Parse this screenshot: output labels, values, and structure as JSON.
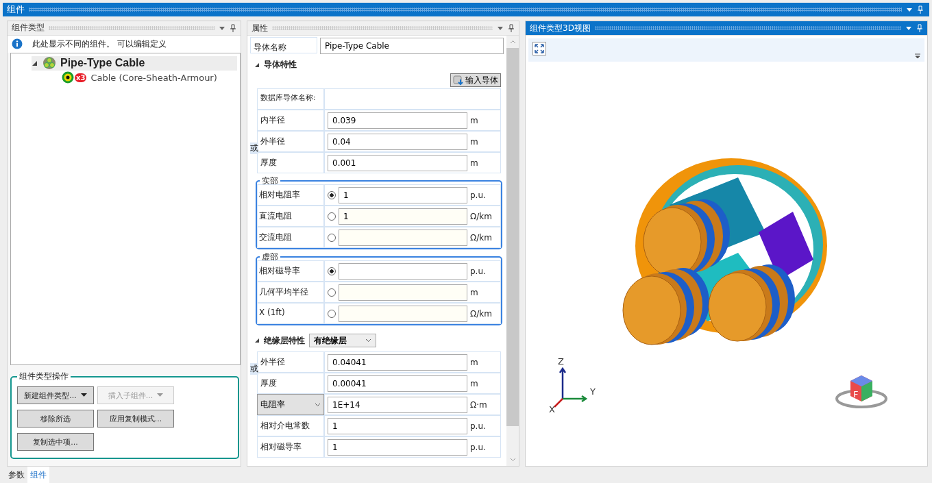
{
  "window": {
    "title": "组件"
  },
  "component_types": {
    "title": "组件类型",
    "info": "此处显示不同的组件。 可以编辑定义",
    "tree": [
      {
        "label": "Pipe-Type Cable",
        "expanded": true,
        "selected": true,
        "children": [
          {
            "label": "Cable (Core-Sheath-Armour)",
            "badge": "x3",
            "selected": false
          }
        ]
      }
    ],
    "operations": {
      "title": "组件类型操作",
      "buttons": [
        {
          "label": "新建组件类型...",
          "kind": "dropdown",
          "disabled": false
        },
        {
          "label": "插入子组件...",
          "kind": "dropdown",
          "disabled": true
        },
        {
          "label": "移除所选",
          "kind": "button",
          "disabled": false
        },
        {
          "label": "应用复制模式...",
          "kind": "button",
          "disabled": false
        },
        {
          "label": "复制选中项...",
          "kind": "button",
          "disabled": false
        }
      ]
    }
  },
  "properties": {
    "title": "属性",
    "name_label": "导体名称",
    "name_value": "Pipe-Type Cable",
    "conductor": {
      "title": "导体特性",
      "expanded": true,
      "import_button": "输入导体",
      "db_label": "数据库导体名称:",
      "rows": [
        {
          "label": "内半径",
          "value": "0.039",
          "unit": "m"
        },
        {
          "label": "外半径",
          "value": "0.04",
          "unit": "m"
        },
        {
          "label": "厚度",
          "value": "0.001",
          "unit": "m",
          "or_label": "或"
        }
      ],
      "groups": [
        {
          "title": "实部",
          "rows": [
            {
              "kind": "radio",
              "label": "相对电阻率",
              "selected": true,
              "value": "1",
              "unit": "p.u."
            },
            {
              "kind": "radio",
              "label": "直流电阻",
              "selected": false,
              "value": "1",
              "unit": "Ω/km"
            },
            {
              "kind": "radio",
              "label": "交流电阻",
              "selected": false,
              "unit": "Ω/km"
            }
          ]
        },
        {
          "title": "虚部",
          "rows": [
            {
              "kind": "radio",
              "label": "相对磁导率",
              "selected": true,
              "unit": "p.u."
            },
            {
              "kind": "radio",
              "label": "几何平均半径",
              "selected": false,
              "unit": "m"
            },
            {
              "kind": "radio",
              "label": "X (1ft)",
              "selected": false,
              "unit": "Ω/km"
            }
          ]
        }
      ]
    },
    "insulation": {
      "title": "绝缘层特性",
      "expanded": true,
      "dropdown": "有绝缘层",
      "rows": [
        {
          "kind": "field",
          "label": "外半径",
          "value": "0.04041",
          "unit": "m"
        },
        {
          "kind": "field",
          "label": "厚度",
          "value": "0.00041",
          "unit": "m",
          "or_label": "或"
        },
        {
          "kind": "dropdown",
          "label": "电阻率",
          "value": "1E+14",
          "unit": "Ω·m"
        },
        {
          "kind": "field",
          "label": "相对介电常数",
          "value": "1",
          "unit": "p.u."
        },
        {
          "kind": "field",
          "label": "相对磁导率",
          "value": "1",
          "unit": "p.u."
        }
      ]
    }
  },
  "view3d": {
    "title": "组件类型3D视图",
    "axes": [
      "Z",
      "Y",
      "X"
    ],
    "cube_label": "F"
  },
  "bottom_tabs": [
    {
      "label": "参数",
      "selected": false
    },
    {
      "label": "组件",
      "selected": true
    }
  ]
}
